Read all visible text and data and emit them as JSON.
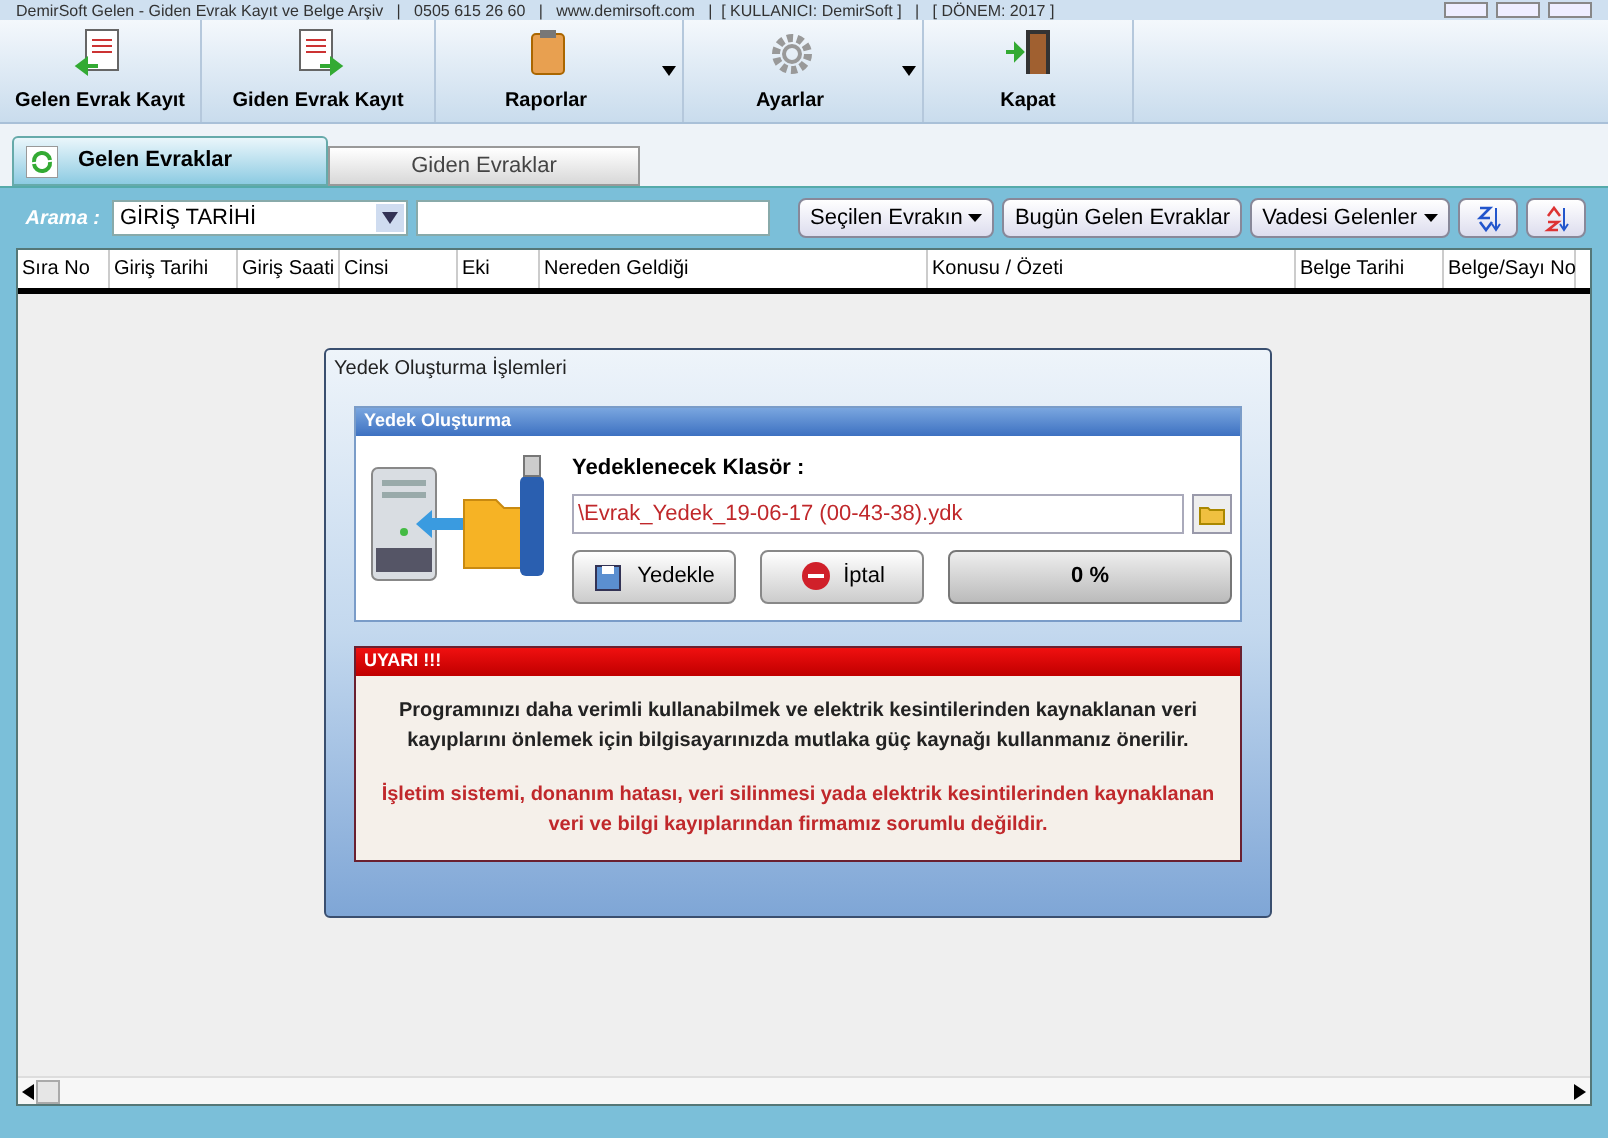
{
  "window": {
    "title": "DemirSoft Gelen - Giden Evrak Kayıt ve Belge Arşiv   |   0505 615 26 60   |   www.demirsoft.com   |  [ KULLANICI: DemirSoft ]   |   [ DÖNEM: 2017 ]"
  },
  "toolbar": [
    {
      "label": "Gelen Evrak Kayıt",
      "kind": "incoming",
      "dropdown": false
    },
    {
      "label": "Giden Evrak Kayıt",
      "kind": "outgoing",
      "dropdown": false
    },
    {
      "label": "Raporlar",
      "kind": "reports",
      "dropdown": true
    },
    {
      "label": "Ayarlar",
      "kind": "settings",
      "dropdown": true
    },
    {
      "label": "Kapat",
      "kind": "exit",
      "dropdown": false
    }
  ],
  "tabs": [
    {
      "label": "Gelen Evraklar",
      "selected": true
    },
    {
      "label": "Giden Evraklar",
      "selected": false
    }
  ],
  "search": {
    "label": "Arama :",
    "field": "GİRİŞ TARİHİ"
  },
  "filter_buttons": [
    {
      "label": "Seçilen Evrakın",
      "dropdown": true
    },
    {
      "label": "Bugün Gelen Evraklar",
      "dropdown": false
    },
    {
      "label": "Vadesi Gelenler",
      "dropdown": true
    }
  ],
  "table": {
    "columns": [
      "Sıra No",
      "Giriş Tarihi",
      "Giriş Saati",
      "Cinsi",
      "Eki",
      "Nereden Geldiği",
      "Konusu / Özeti",
      "Belge Tarihi",
      "Belge/Sayı No"
    ]
  },
  "dialog": {
    "title": "Yedek Oluşturma İşlemleri",
    "section": "Yedek Oluşturma",
    "folder_label": "Yedeklenecek Klasör :",
    "folder_value": "\\Evrak_Yedek_19-06-17 (00-43-38).ydk",
    "backup_button": "Yedekle",
    "cancel_button": "İptal",
    "progress": {
      "level": 0,
      "reading": "0 %"
    },
    "warning": {
      "title": "UYARI !!!",
      "text": "Programınızı daha verimli kullanabilmek ve elektrik kesintilerinden kaynaklanan veri kayıplarını önlemek için bilgisayarınızda mutlaka güç kaynağı kullanmanız önerilir.",
      "disclaimer": "İşletim sistemi, donanım hatası, veri silinmesi yada elektrik kesintilerinden kaynaklanan veri ve bilgi kayıplarından firmamız sorumlu değildir."
    }
  }
}
